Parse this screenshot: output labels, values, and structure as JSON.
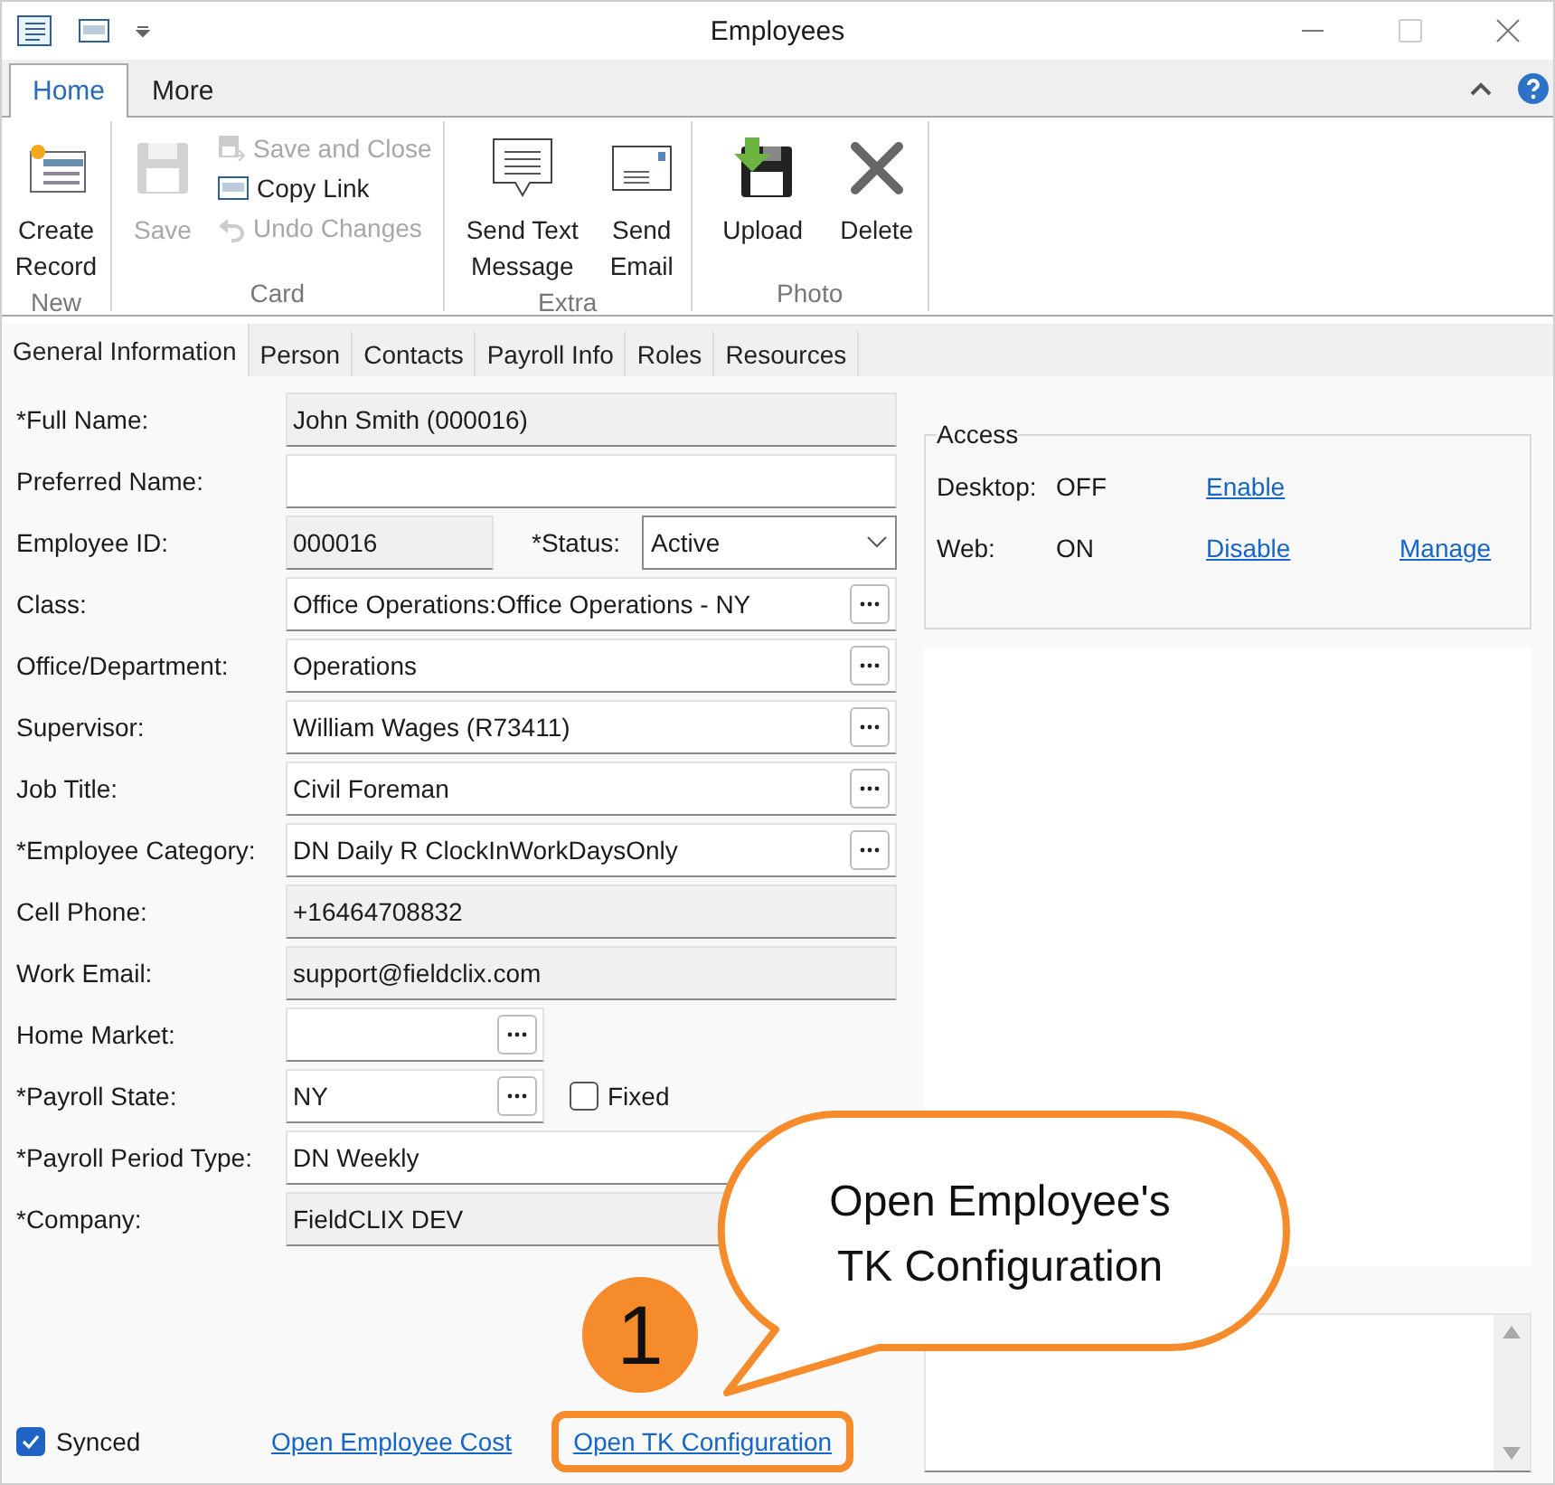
{
  "window": {
    "title": "Employees"
  },
  "ribbon": {
    "tabs": [
      {
        "label": "Home",
        "selected": true
      },
      {
        "label": "More",
        "selected": false
      }
    ],
    "groups": [
      {
        "label": "New",
        "items": [
          {
            "kind": "large",
            "label": "Create Record",
            "disabled": false
          }
        ]
      },
      {
        "label": "Card",
        "items": [
          {
            "kind": "large",
            "label": "Save",
            "disabled": true
          },
          {
            "kind": "small",
            "label": "Save and Close",
            "disabled": true
          },
          {
            "kind": "small",
            "label": "Copy Link",
            "disabled": false
          },
          {
            "kind": "small",
            "label": "Undo Changes",
            "disabled": true
          }
        ]
      },
      {
        "label": "Extra",
        "items": [
          {
            "kind": "large",
            "label": "Send Text Message",
            "disabled": false
          },
          {
            "kind": "large",
            "label": "Send Email",
            "disabled": false
          }
        ]
      },
      {
        "label": "Photo",
        "items": [
          {
            "kind": "large",
            "label": "Upload",
            "disabled": false
          },
          {
            "kind": "large",
            "label": "Delete",
            "disabled": false
          }
        ]
      }
    ]
  },
  "form_tabs": [
    {
      "label": "General Information",
      "selected": true
    },
    {
      "label": "Person",
      "selected": false
    },
    {
      "label": "Contacts",
      "selected": false
    },
    {
      "label": "Payroll Info",
      "selected": false
    },
    {
      "label": "Roles",
      "selected": false
    },
    {
      "label": "Resources",
      "selected": false
    }
  ],
  "fields": [
    {
      "label": "*Full Name:",
      "kind": "readonly",
      "value": "John Smith (000016)"
    },
    {
      "label": "Preferred Name:",
      "kind": "text"
    },
    {
      "label": "Employee ID:",
      "kind": "readonly-short",
      "value": "000016",
      "status": {
        "label": "*Status:",
        "value": "Active"
      }
    },
    {
      "label": "Class:",
      "kind": "lookup",
      "value": "Office Operations:Office Operations - NY"
    },
    {
      "label": "Office/Department:",
      "kind": "lookup",
      "value": "Operations"
    },
    {
      "label": "Supervisor:",
      "kind": "lookup",
      "value": "William Wages (R73411)"
    },
    {
      "label": "Job Title:",
      "kind": "lookup",
      "value": "Civil Foreman"
    },
    {
      "label": "*Employee Category:",
      "kind": "lookup",
      "value": "DN Daily R ClockInWorkDaysOnly"
    },
    {
      "label": "Cell Phone:",
      "kind": "readonly",
      "value": "+16464708832"
    },
    {
      "label": "Work Email:",
      "kind": "readonly",
      "value": "support@fieldclix.com"
    },
    {
      "label": "Home Market:",
      "kind": "lookup-short"
    },
    {
      "label": "*Payroll State:",
      "kind": "lookup-short",
      "value": "NY",
      "checkbox": {
        "label": "Fixed",
        "checked": false
      }
    },
    {
      "label": "*Payroll Period Type:",
      "kind": "text",
      "value": "DN Weekly"
    },
    {
      "label": "*Company:",
      "kind": "readonly",
      "value": "FieldCLIX DEV"
    }
  ],
  "access": {
    "title": "Access",
    "rows": [
      {
        "label": "Desktop:",
        "state": "OFF",
        "links": [
          "Enable"
        ]
      },
      {
        "label": "Web:",
        "state": "ON",
        "links": [
          "Disable",
          "Manage"
        ]
      }
    ]
  },
  "footer": {
    "synced": {
      "label": "Synced",
      "checked": true
    },
    "links": [
      {
        "label": "Open Employee Cost",
        "highlighted": false
      },
      {
        "label": "Open TK Configuration",
        "highlighted": true
      }
    ]
  },
  "callout": {
    "number": "1",
    "text": "Open Employee's TK Configuration"
  }
}
